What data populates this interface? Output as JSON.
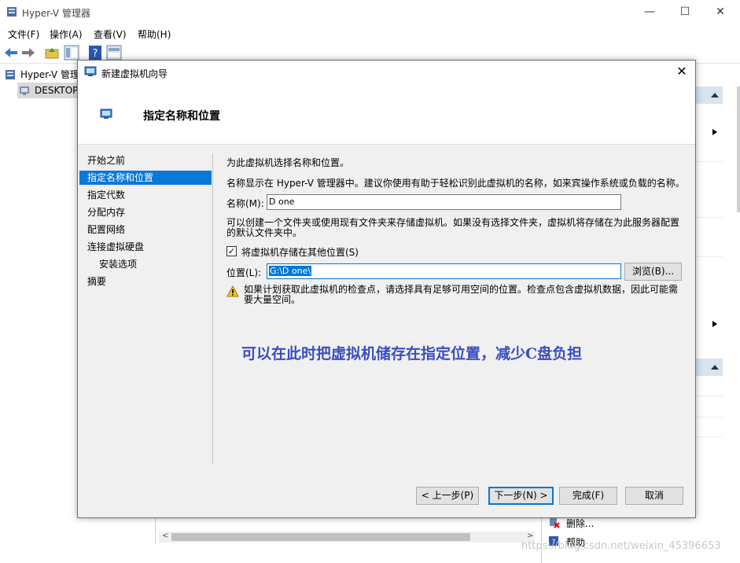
{
  "app": {
    "title": "Hyper-V 管理器",
    "window_controls": {
      "minimize": "—",
      "maximize": "☐",
      "close": "✕"
    }
  },
  "menu": [
    "文件(F)",
    "操作(A)",
    "查看(V)",
    "帮助(H)"
  ],
  "tree": {
    "root": "Hyper-V 管理",
    "child": "DESKTOP"
  },
  "actions_lower": {
    "delete": "删除...",
    "help": "帮助"
  },
  "watermark": "https://blog.csdn.net/weixin_45396653",
  "dialog": {
    "title": "新建虚拟机向导",
    "close": "✕",
    "header": "指定名称和位置",
    "nav": [
      "开始之前",
      "指定名称和位置",
      "指定代数",
      "分配内存",
      "配置网络",
      "连接虚拟硬盘",
      "安装选项",
      "摘要"
    ],
    "intro": "为此虚拟机选择名称和位置。",
    "name_desc": "名称显示在 Hyper-V 管理器中。建议你使用有助于轻松识别此虚拟机的名称，如来宾操作系统或负载的名称。",
    "name_label": "名称(M):",
    "name_value": "D one",
    "folder_desc_1": "可以创建一个文件夹或使用现有文件夹来存储虚拟机。如果没有选择文件夹，虚拟机将存储在为此服务器配置",
    "folder_desc_2": "的默认文件夹中。",
    "checkbox_label": "将虚拟机存储在其他位置(S)",
    "checkbox_checked": "✓",
    "location_label": "位置(L):",
    "location_value": "G:\\D one\\",
    "browse": "浏览(B)...",
    "warning_1": "如果计划获取此虚拟机的检查点，请选择具有足够可用空间的位置。检查点包含虚拟机数据，因此可能需",
    "warning_2": "要大量空间。",
    "annotation": "可以在此时把虚拟机储存在指定位置，减少C盘负担",
    "buttons": {
      "prev": "< 上一步(P)",
      "next": "下一步(N) >",
      "finish": "完成(F)",
      "cancel": "取消"
    }
  }
}
